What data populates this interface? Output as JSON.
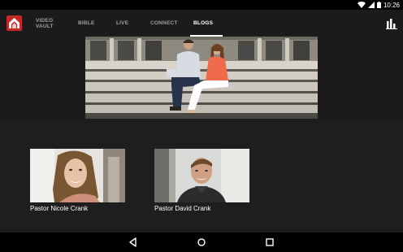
{
  "status_bar": {
    "time": "10:26",
    "icons": [
      "wifi-icon",
      "signal-icon",
      "battery-icon"
    ]
  },
  "app_bar": {
    "logo": "church-logo-icon",
    "tabs": [
      {
        "label_line1": "VIDEO",
        "label_line2": "VAULT",
        "active": false
      },
      {
        "label": "BIBLE",
        "active": false
      },
      {
        "label": "LIVE",
        "active": false
      },
      {
        "label": "CONNECT",
        "active": false
      },
      {
        "label": "BLOGS",
        "active": true
      }
    ],
    "action_icon": "bar-chart-icon"
  },
  "hero": {
    "image": "couple-sitting-on-steps-photo"
  },
  "blogs": [
    {
      "name": "Pastor Nicole Crank",
      "image": "nicole-crank-portrait"
    },
    {
      "name": "Pastor David Crank",
      "image": "david-crank-portrait"
    }
  ],
  "nav_bar": {
    "buttons": [
      "back-icon",
      "home-icon",
      "recent-apps-icon"
    ]
  },
  "colors": {
    "brand_red": "#c62828",
    "background": "#1e1e1e",
    "app_bar": "#1b1b1b"
  }
}
